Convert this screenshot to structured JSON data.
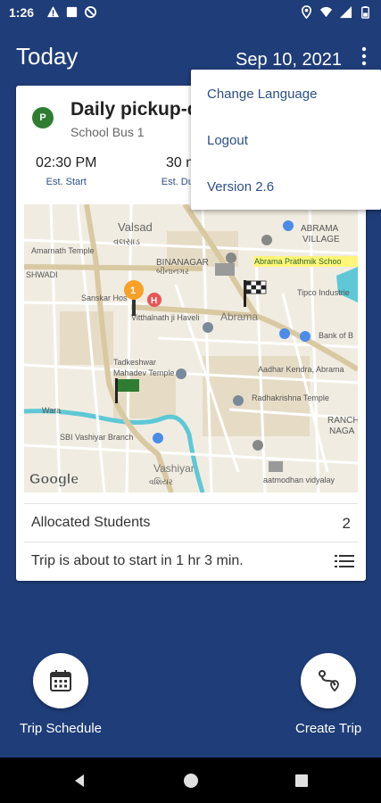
{
  "status_bar": {
    "time": "1:26",
    "left_icons": [
      "warning-icon",
      "square-icon",
      "no-disturb-icon"
    ],
    "right_icons": [
      "location-icon",
      "wifi-icon",
      "signal-icon",
      "battery-icon"
    ]
  },
  "app_bar": {
    "title": "Today",
    "date": "Sep 10, 2021",
    "overflow_icon": "more-vert-icon"
  },
  "menu": {
    "items": [
      {
        "label": "Change Language"
      },
      {
        "label": "Logout"
      },
      {
        "label": "Version 2.6"
      }
    ]
  },
  "trip_card": {
    "badge": "P",
    "badge_color": "#2e7d32",
    "title": "Daily pickup-d",
    "bus": "School Bus 1",
    "start_time": "02:30 PM",
    "start_label": "Est. Start",
    "duration_value": "30 m",
    "duration_label": "Est. Du",
    "map": {
      "labels": {
        "valsad": "Valsad",
        "valsad_gu": "વલસાડ",
        "abrama_village": "ABRAMA",
        "abrama_village2": "VILLAGE",
        "amarnath": "Amarnath Temple",
        "binanagar": "BINANAGAR",
        "binanagar_gu": "બીનાનગર",
        "abrama_school": "Abrama Prathmik Schoo",
        "shwadi": "SHWADI",
        "sanskar": "Sanskar Hos",
        "tipco": "Tipco Industrie",
        "vitthalnath": "Vitthalnath ji Haveli",
        "abrama": "Abrama",
        "bank": "Bank of B",
        "tadkeshwar": "Tadkeshwar",
        "mahadev": "Mahadev Temple",
        "aadhar": "Aadhar Kendra, Abrama",
        "radhakrishna": "Radhakrishna Temple",
        "ranchho": "RANCH",
        "ranchho2": "NAGA",
        "sbi": "SBI Vashiyar Branch",
        "vashiyar": "Vashiyar",
        "vashiyar_gu": "વશિયર",
        "vidyalay": "aatmodhan vidyalay",
        "wara": "Wara",
        "google": "Google"
      },
      "pin_count": "1"
    },
    "students_label": "Allocated Students",
    "students_count": "2",
    "status_text": "Trip is about to start in 1 hr 3 min."
  },
  "bottom_actions": {
    "schedule_label": "Trip Schedule",
    "create_label": "Create Trip"
  },
  "nav": [
    "back-icon",
    "home-icon",
    "recents-icon"
  ],
  "colors": {
    "primary": "#1f3d78",
    "accent_text": "#2c4f8a",
    "map_bg": "#f1ece1",
    "road": "#d9c9a3",
    "water": "#5ec8d6"
  }
}
